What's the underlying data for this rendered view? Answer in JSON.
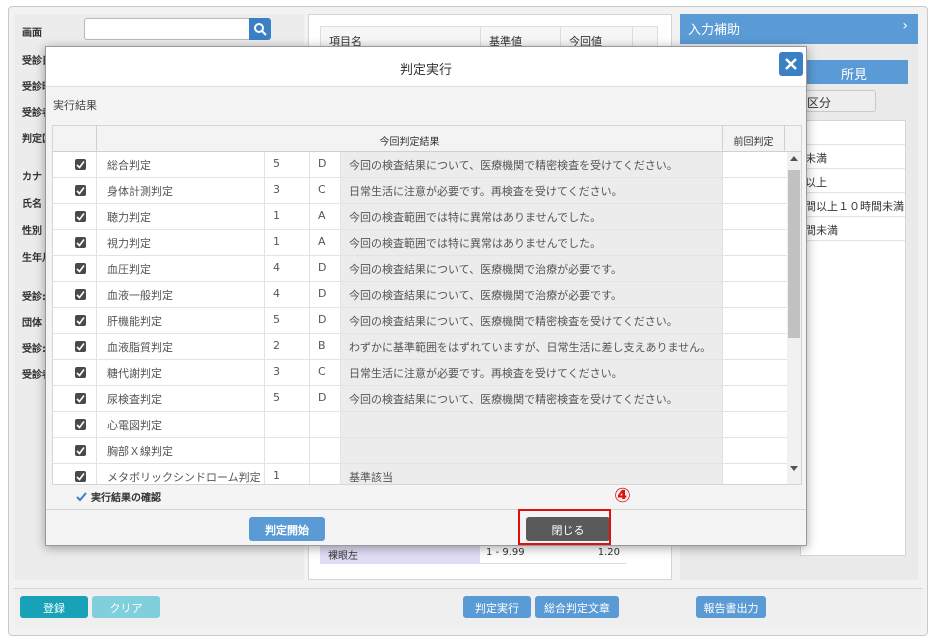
{
  "background": {
    "left_labels": [
      "画面",
      "受診日",
      "受診時",
      "受診者",
      "判定区",
      "カナ",
      "氏名",
      "性別",
      "生年月",
      "受診:",
      "団体",
      "受診:",
      "受診者"
    ],
    "table_headers": [
      "項目名",
      "基準値",
      "今回値"
    ],
    "row": {
      "name": "裸眼左",
      "range": "1 - 9.99",
      "value": "1.20"
    },
    "aux_title": "入力補助",
    "aux_chevron": "›",
    "shoken_tab": "所見",
    "kubun_label": "区分",
    "right_list": [
      "未満",
      "以上",
      "間以上１０時間未満",
      "間未満"
    ]
  },
  "footer": {
    "register": "登録",
    "clear": "クリア",
    "run_judgment": "判定実行",
    "summary_text": "総合判定文章",
    "report_output": "報告書出力"
  },
  "modal": {
    "title": "判定実行",
    "section_label": "実行結果",
    "header_current": "今回判定結果",
    "header_prev": "前回判定",
    "rows": [
      {
        "name": "総合判定",
        "code": "5",
        "grade": "D",
        "comment": "今回の検査結果について、医療機関で精密検査を受けてください。",
        "checked": true
      },
      {
        "name": "身体計測判定",
        "code": "3",
        "grade": "C",
        "comment": "日常生活に注意が必要です。再検査を受けてください。",
        "checked": true
      },
      {
        "name": "聴力判定",
        "code": "1",
        "grade": "A",
        "comment": "今回の検査範囲では特に異常はありませんでした。",
        "checked": true
      },
      {
        "name": "視力判定",
        "code": "1",
        "grade": "A",
        "comment": "今回の検査範囲では特に異常はありませんでした。",
        "checked": true
      },
      {
        "name": "血圧判定",
        "code": "4",
        "grade": "D",
        "comment": "今回の検査結果について、医療機関で治療が必要です。",
        "checked": true
      },
      {
        "name": "血液一般判定",
        "code": "4",
        "grade": "D",
        "comment": "今回の検査結果について、医療機関で治療が必要です。",
        "checked": true
      },
      {
        "name": "肝機能判定",
        "code": "5",
        "grade": "D",
        "comment": "今回の検査結果について、医療機関で精密検査を受けてください。",
        "checked": true
      },
      {
        "name": "血液脂質判定",
        "code": "2",
        "grade": "B",
        "comment": "わずかに基準範囲をはずれていますが、日常生活に差し支えありません。",
        "checked": true
      },
      {
        "name": "糖代謝判定",
        "code": "3",
        "grade": "C",
        "comment": "日常生活に注意が必要です。再検査を受けてください。",
        "checked": true
      },
      {
        "name": "尿検査判定",
        "code": "5",
        "grade": "D",
        "comment": "今回の検査結果について、医療機関で精密検査を受けてください。",
        "checked": true
      },
      {
        "name": "心電図判定",
        "code": "",
        "grade": "",
        "comment": "",
        "checked": true
      },
      {
        "name": "胸部Ｘ線判定",
        "code": "",
        "grade": "",
        "comment": "",
        "checked": true
      },
      {
        "name": "メタボリックシンドローム判定",
        "code": "1",
        "grade": "",
        "comment": "基準該当",
        "checked": true
      }
    ],
    "confirm_label": "実行結果の確認",
    "confirm_checked": true,
    "start_button": "判定開始",
    "close_button": "閉じる",
    "annotation": "④"
  },
  "colors": {
    "accent": "#3b7fc4",
    "button_blue": "#5b9bd5",
    "button_dark": "#5a5a5a",
    "register_green": "#17a2b8",
    "highlight_red": "#e01010"
  }
}
